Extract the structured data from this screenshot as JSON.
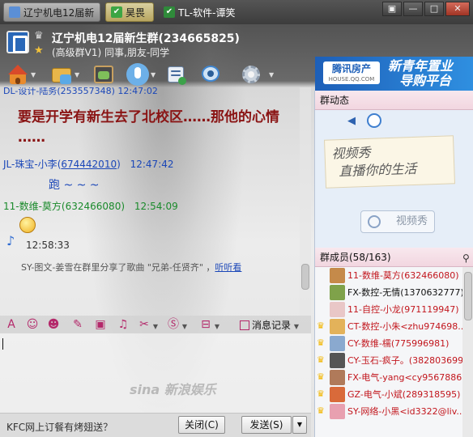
{
  "tabs": [
    {
      "label": "辽宁机电12届新"
    },
    {
      "label": "昊畏"
    },
    {
      "label": "TL-软件-谭笑"
    }
  ],
  "window_buttons": {
    "menu": "▣",
    "minimize": "—",
    "maximize": "□",
    "close": "✕"
  },
  "group": {
    "title": "辽宁机电12届新生群(234665825)",
    "subtitle": "(高级群V1) 同事,朋友-同学"
  },
  "ad_banner": {
    "logo": "腾讯房产",
    "logo_sub": "HOUSE.QQ.COM",
    "line1": "新青年置业",
    "line2": "导购平台"
  },
  "chat": {
    "partial_header": "DL-设计-陆务(253557348)  12:47:02",
    "msg1": "要是开学有新生去了北校区……那他的心情",
    "msg1_cont": "……",
    "sender2": "JL-珠宝-小李",
    "sender2_id": "674442010",
    "time2": "12:47:42",
    "msg2": "跑  ~ ~ ~",
    "sender3": "11-数维-莫方(632466080)",
    "time3": "12:54:09",
    "time4": "12:58:33",
    "share_text": "SY-图文-姜雪在群里分享了歌曲 \"兄弟-任贤齐\" ，",
    "share_link": "听听看"
  },
  "input_toolbar": {
    "record_label": "消息记录"
  },
  "watermark": "sina 新浪娱乐",
  "bottom": {
    "ad_text": "KFC网上订餐有烤翅送？",
    "close_label": "关闭(C)",
    "send_label": "发送(S)"
  },
  "right": {
    "dynamic_title": "群动态",
    "video_note_line1": "视频秀",
    "video_note_line2": "直播你的生活",
    "video_button": "视频秀",
    "members_title": "群成员(58/163)",
    "members": [
      {
        "name": "11-数维-莫方(632466080)",
        "crown": false,
        "color": "red"
      },
      {
        "name": "FX-数控-无情(1370632777)",
        "crown": false,
        "color": "dark"
      },
      {
        "name": "11-自控-小龙(971119947)",
        "crown": false,
        "color": "red"
      },
      {
        "name": "CT-数控-小朱<zhu974698...",
        "crown": true,
        "color": "red"
      },
      {
        "name": "CY-数维-檽(775996981)",
        "crown": true,
        "color": "red"
      },
      {
        "name": "CY-玉石-疯子。(382803699)",
        "crown": true,
        "color": "red"
      },
      {
        "name": "FX-电气-yang<cy9567886...",
        "crown": true,
        "color": "red"
      },
      {
        "name": "GZ-电气-小斌(289318595)",
        "crown": true,
        "color": "red"
      },
      {
        "name": "SY-网络-小黑<id3322@liv...",
        "crown": true,
        "color": "red"
      }
    ]
  }
}
